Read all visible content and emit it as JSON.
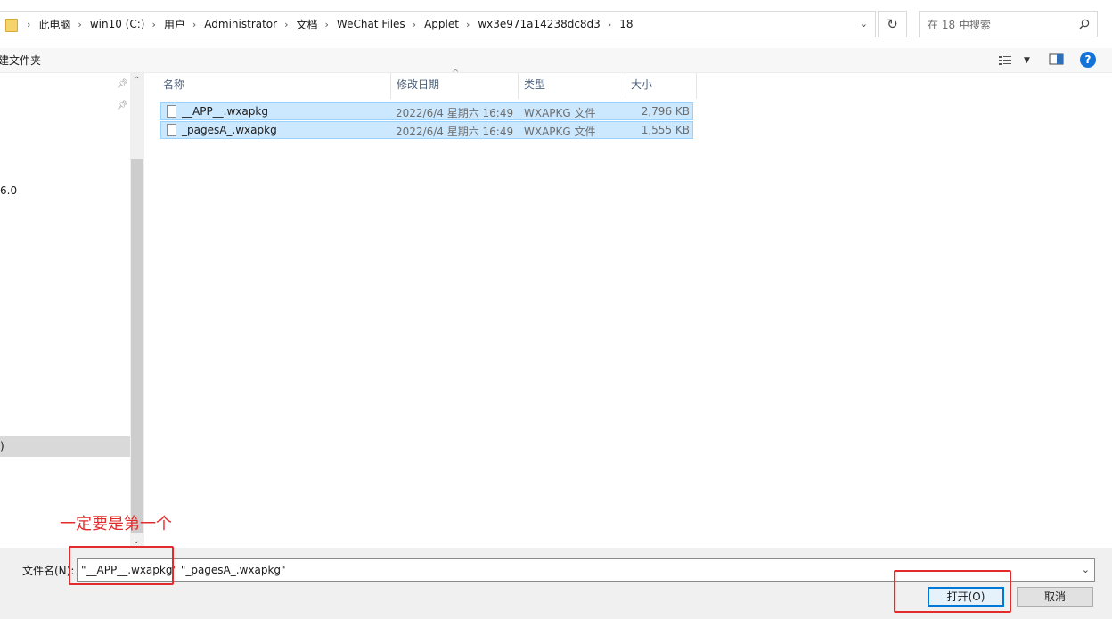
{
  "address": {
    "crumbs": [
      "此电脑",
      "win10 (C:)",
      "用户",
      "Administrator",
      "文档",
      "WeChat Files",
      "Applet",
      "wx3e971a14238dc8d3",
      "18"
    ],
    "search_placeholder": "在 18 中搜索"
  },
  "toolbar": {
    "new_folder_label": "建文件夹",
    "help_label": "?"
  },
  "nav": {
    "partial_text_1": "6.0",
    "partial_text_2": ")"
  },
  "columns": {
    "name": "名称",
    "date": "修改日期",
    "type": "类型",
    "size": "大小"
  },
  "files": [
    {
      "name": "__APP__.wxapkg",
      "date": "2022/6/4 星期六 16:49",
      "type": "WXAPKG 文件",
      "size": "2,796 KB"
    },
    {
      "name": "_pagesA_.wxapkg",
      "date": "2022/6/4 星期六 16:49",
      "type": "WXAPKG 文件",
      "size": "1,555 KB"
    }
  ],
  "bottom": {
    "filename_label": "文件名(N):",
    "filename_value_1": "\"__APP__.wxapkg\"",
    "filename_value_2": " \"_pagesA_.wxapkg\"",
    "open_button": "打开(O)",
    "cancel_button": "取消"
  },
  "annotation": {
    "text": "一定要是第一个",
    "color": "#e32b2b"
  },
  "colors": {
    "selection_bg": "#cce8ff",
    "selection_border": "#99d1ff",
    "header_text": "#4c607a",
    "accent": "#0078d7"
  }
}
